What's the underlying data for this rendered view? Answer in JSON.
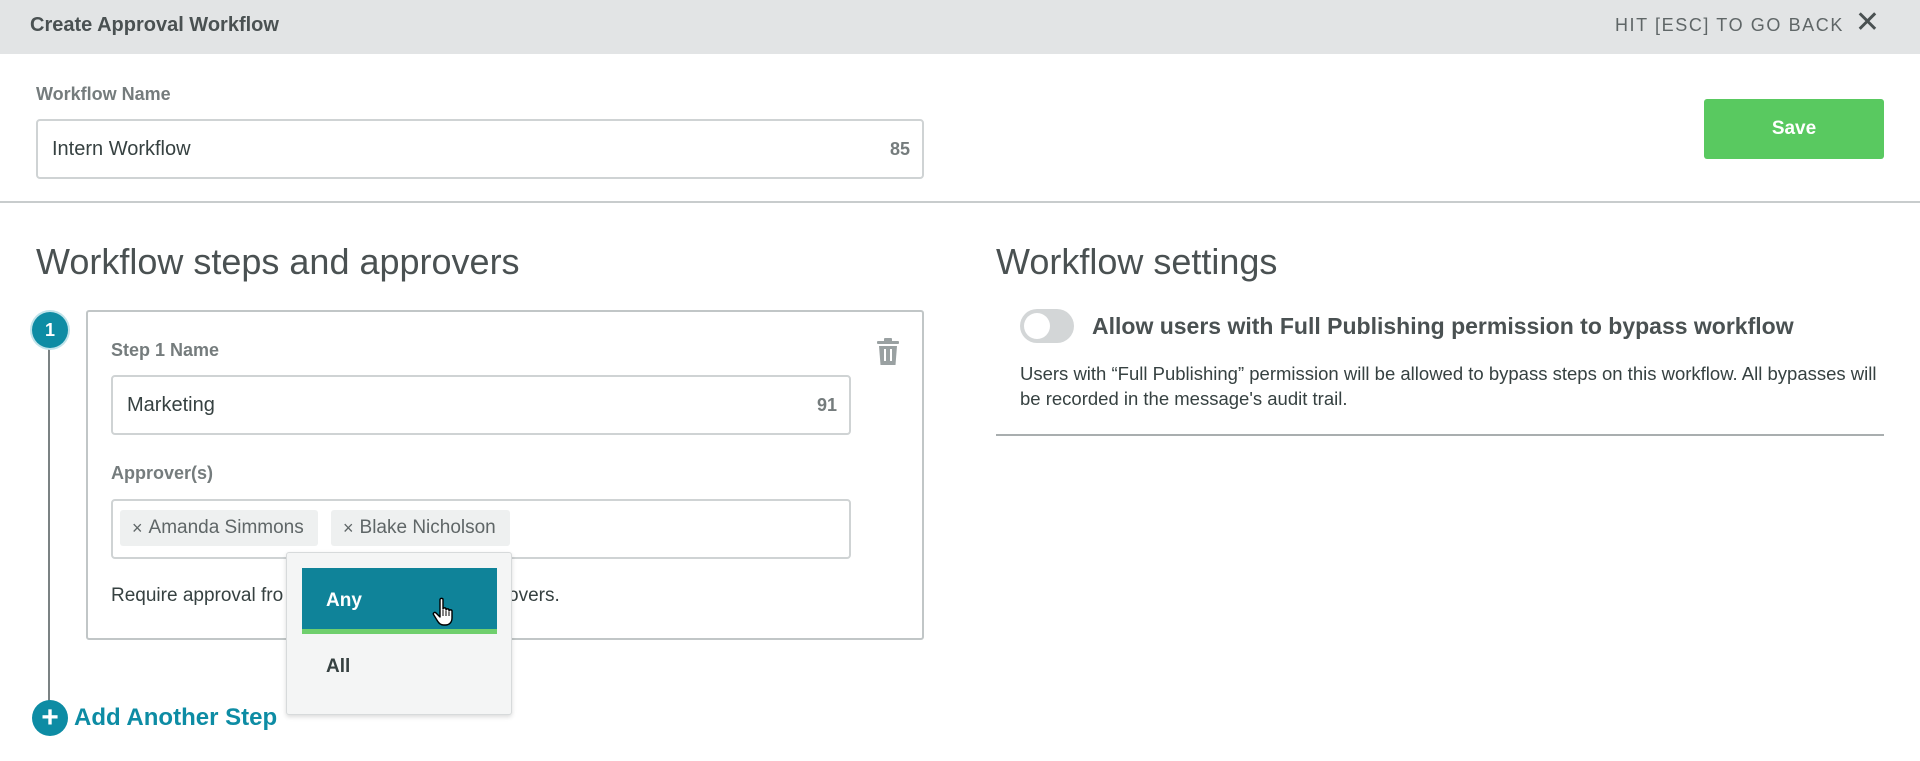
{
  "header": {
    "title": "Create Approval Workflow",
    "esc_hint": "HIT [ESC] TO GO BACK",
    "close_glyph": "✕"
  },
  "workflow_name": {
    "label": "Workflow Name",
    "value": "Intern Workflow",
    "chars_remaining": "85"
  },
  "save_label": "Save",
  "steps_section": {
    "heading": "Workflow steps and approvers",
    "steps": [
      {
        "number": "1",
        "name_label": "Step 1 Name",
        "name_value": "Marketing",
        "chars_remaining": "91",
        "approvers_label": "Approver(s)",
        "approvers": [
          "Amanda Simmons",
          "Blake Nicholson"
        ],
        "remove_glyph": "×",
        "requirement_prefix": "Require approval fro",
        "requirement_suffix": "overs."
      }
    ],
    "dropdown_options": [
      {
        "label": "Any",
        "selected": true
      },
      {
        "label": "All",
        "selected": false
      }
    ],
    "add_step_label": "Add Another Step",
    "add_step_glyph": "+"
  },
  "settings_section": {
    "heading": "Workflow settings",
    "bypass_toggle": {
      "label": "Allow users with Full Publishing permission to bypass workflow",
      "enabled": false
    },
    "bypass_description": "Users with “Full Publishing” permission will be allowed to bypass steps on this workflow. All bypasses will be recorded in the message's audit trail."
  },
  "colors": {
    "accent_teal": "#0d8ca4",
    "save_green": "#59c960",
    "header_bg": "#e2e4e5"
  },
  "icons": {
    "close": "close-icon",
    "trash": "trash-icon",
    "plus": "plus-circle-icon",
    "cursor": "hand-pointer-icon"
  }
}
